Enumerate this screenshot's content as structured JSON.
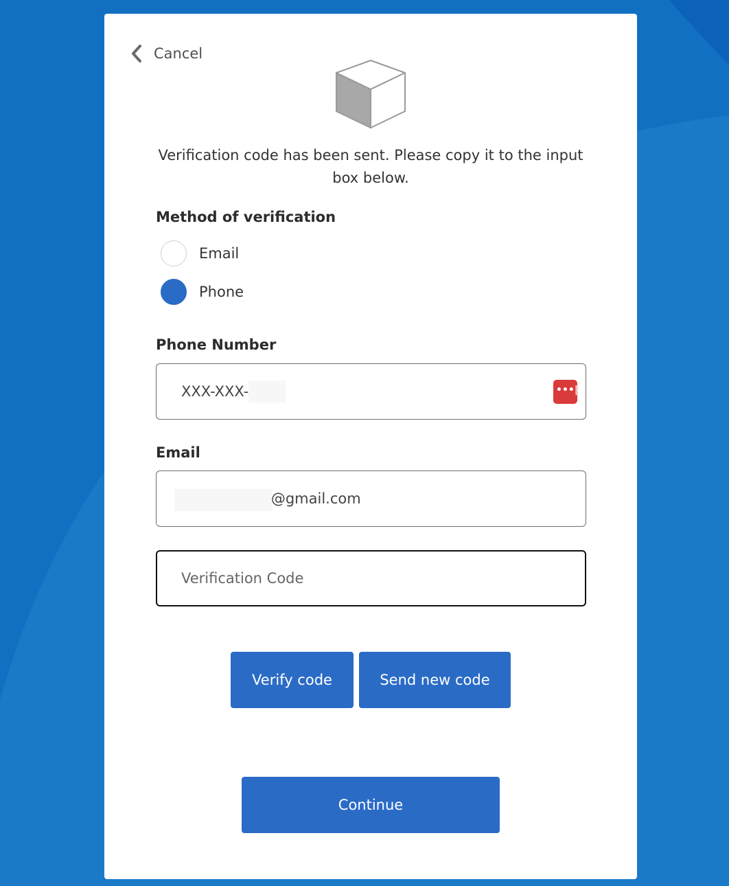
{
  "header": {
    "cancel_label": "Cancel",
    "intro_text": "Verification code has been sent. Please copy it to the input box below."
  },
  "verification_method": {
    "label": "Method of verification",
    "options": [
      {
        "label": "Email",
        "selected": false
      },
      {
        "label": "Phone",
        "selected": true
      }
    ]
  },
  "phone": {
    "label": "Phone Number",
    "value": "XXX-XXX-"
  },
  "email": {
    "label": "Email",
    "value": "i@gmail.com"
  },
  "verification_code": {
    "value": "",
    "placeholder": "Verification Code"
  },
  "buttons": {
    "verify_label": "Verify code",
    "send_new_label": "Send new code",
    "continue_label": "Continue"
  },
  "colors": {
    "background": "#1270c2",
    "accent": "#2a6bc6",
    "password_manager_icon": "#d93a3a"
  },
  "icons": {
    "back": "chevron-left-icon",
    "logo": "cube-logo",
    "password_manager": "password-manager-icon"
  }
}
